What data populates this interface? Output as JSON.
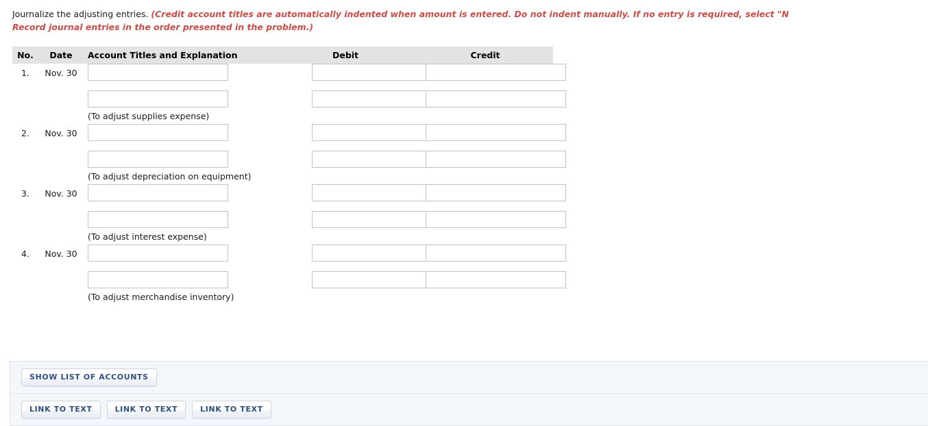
{
  "instructions": {
    "prompt": "Journalize the adjusting entries.",
    "hint_line1": "(Credit account titles are automatically indented when amount is entered. Do not indent manually. If no entry is required, select \"N",
    "hint_line2": "Record journal entries in the order presented in the problem.)"
  },
  "table": {
    "headers": {
      "no": "No.",
      "date": "Date",
      "account": "Account Titles and Explanation",
      "debit": "Debit",
      "credit": "Credit"
    },
    "entries": [
      {
        "no": "1.",
        "date": "Nov. 30",
        "explanation": "(To adjust supplies expense)",
        "lines": [
          {
            "account": "",
            "debit": "",
            "credit": ""
          },
          {
            "account": "",
            "debit": "",
            "credit": ""
          }
        ]
      },
      {
        "no": "2.",
        "date": "Nov. 30",
        "explanation": "(To adjust depreciation on equipment)",
        "lines": [
          {
            "account": "",
            "debit": "",
            "credit": ""
          },
          {
            "account": "",
            "debit": "",
            "credit": ""
          }
        ]
      },
      {
        "no": "3.",
        "date": "Nov. 30",
        "explanation": "(To adjust interest expense)",
        "lines": [
          {
            "account": "",
            "debit": "",
            "credit": ""
          },
          {
            "account": "",
            "debit": "",
            "credit": ""
          }
        ]
      },
      {
        "no": "4.",
        "date": "Nov. 30",
        "explanation": "(To adjust merchandise inventory)",
        "lines": [
          {
            "account": "",
            "debit": "",
            "credit": ""
          },
          {
            "account": "",
            "debit": "",
            "credit": ""
          }
        ]
      }
    ]
  },
  "panels": {
    "accounts_button": "SHOW LIST OF ACCOUNTS",
    "link_buttons": [
      "LINK TO TEXT",
      "LINK TO TEXT",
      "LINK TO TEXT"
    ]
  },
  "colors": {
    "hint_red": "#d14b45",
    "button_text": "#2d4f82",
    "header_band": "#e3e3e3",
    "panel_bg": "#f3f7fb",
    "input_border": "#c3c3c3"
  }
}
